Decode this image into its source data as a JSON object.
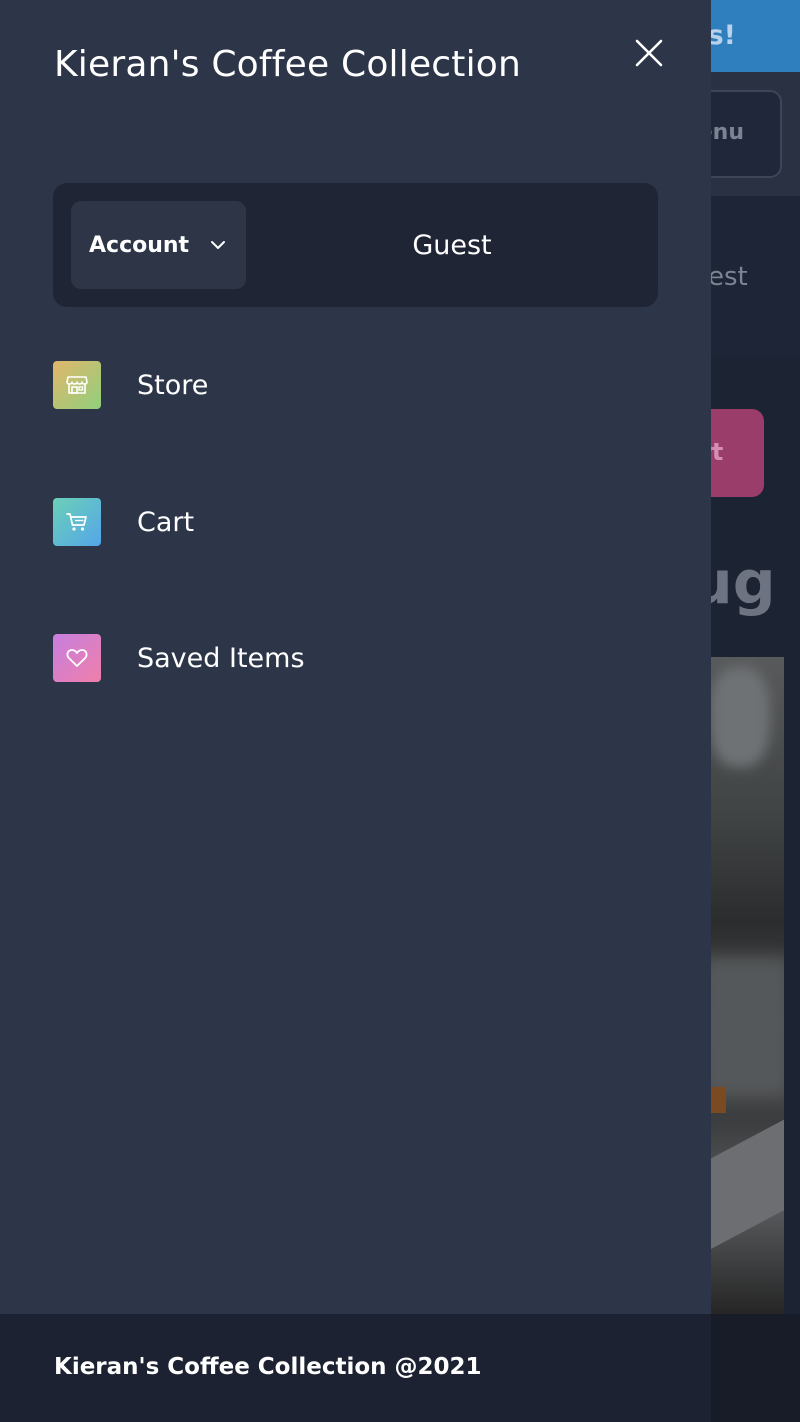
{
  "background": {
    "banner_text": "rs!",
    "menu_button_label": "enu",
    "account_text": "est",
    "cart_button_label": "rt",
    "heading_text": "ug"
  },
  "drawer": {
    "title": "Kieran's Coffee Collection",
    "close_icon": "close-icon",
    "account": {
      "button_label": "Account",
      "chevron_icon": "chevron-down-icon",
      "user_name": "Guest"
    },
    "nav_items": [
      {
        "label": "Store",
        "icon": "store-icon"
      },
      {
        "label": "Cart",
        "icon": "cart-icon"
      },
      {
        "label": "Saved Items",
        "icon": "heart-icon"
      }
    ],
    "footer_text": "Kieran's Coffee Collection @2021"
  },
  "colors": {
    "drawer_bg": "#2d3548",
    "card_bg": "#1f2535",
    "text": "#ffffff",
    "banner": "#2f7fbf",
    "cart_button": "#9b3d6a"
  }
}
